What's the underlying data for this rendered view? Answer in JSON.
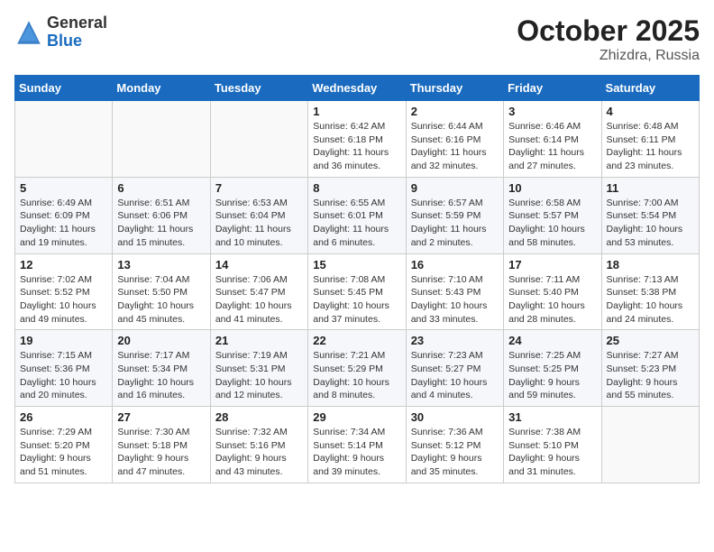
{
  "header": {
    "logo_general": "General",
    "logo_blue": "Blue",
    "month_year": "October 2025",
    "location": "Zhizdra, Russia"
  },
  "calendar": {
    "weekdays": [
      "Sunday",
      "Monday",
      "Tuesday",
      "Wednesday",
      "Thursday",
      "Friday",
      "Saturday"
    ],
    "weeks": [
      [
        {
          "day": "",
          "info": ""
        },
        {
          "day": "",
          "info": ""
        },
        {
          "day": "",
          "info": ""
        },
        {
          "day": "1",
          "info": "Sunrise: 6:42 AM\nSunset: 6:18 PM\nDaylight: 11 hours\nand 36 minutes."
        },
        {
          "day": "2",
          "info": "Sunrise: 6:44 AM\nSunset: 6:16 PM\nDaylight: 11 hours\nand 32 minutes."
        },
        {
          "day": "3",
          "info": "Sunrise: 6:46 AM\nSunset: 6:14 PM\nDaylight: 11 hours\nand 27 minutes."
        },
        {
          "day": "4",
          "info": "Sunrise: 6:48 AM\nSunset: 6:11 PM\nDaylight: 11 hours\nand 23 minutes."
        }
      ],
      [
        {
          "day": "5",
          "info": "Sunrise: 6:49 AM\nSunset: 6:09 PM\nDaylight: 11 hours\nand 19 minutes."
        },
        {
          "day": "6",
          "info": "Sunrise: 6:51 AM\nSunset: 6:06 PM\nDaylight: 11 hours\nand 15 minutes."
        },
        {
          "day": "7",
          "info": "Sunrise: 6:53 AM\nSunset: 6:04 PM\nDaylight: 11 hours\nand 10 minutes."
        },
        {
          "day": "8",
          "info": "Sunrise: 6:55 AM\nSunset: 6:01 PM\nDaylight: 11 hours\nand 6 minutes."
        },
        {
          "day": "9",
          "info": "Sunrise: 6:57 AM\nSunset: 5:59 PM\nDaylight: 11 hours\nand 2 minutes."
        },
        {
          "day": "10",
          "info": "Sunrise: 6:58 AM\nSunset: 5:57 PM\nDaylight: 10 hours\nand 58 minutes."
        },
        {
          "day": "11",
          "info": "Sunrise: 7:00 AM\nSunset: 5:54 PM\nDaylight: 10 hours\nand 53 minutes."
        }
      ],
      [
        {
          "day": "12",
          "info": "Sunrise: 7:02 AM\nSunset: 5:52 PM\nDaylight: 10 hours\nand 49 minutes."
        },
        {
          "day": "13",
          "info": "Sunrise: 7:04 AM\nSunset: 5:50 PM\nDaylight: 10 hours\nand 45 minutes."
        },
        {
          "day": "14",
          "info": "Sunrise: 7:06 AM\nSunset: 5:47 PM\nDaylight: 10 hours\nand 41 minutes."
        },
        {
          "day": "15",
          "info": "Sunrise: 7:08 AM\nSunset: 5:45 PM\nDaylight: 10 hours\nand 37 minutes."
        },
        {
          "day": "16",
          "info": "Sunrise: 7:10 AM\nSunset: 5:43 PM\nDaylight: 10 hours\nand 33 minutes."
        },
        {
          "day": "17",
          "info": "Sunrise: 7:11 AM\nSunset: 5:40 PM\nDaylight: 10 hours\nand 28 minutes."
        },
        {
          "day": "18",
          "info": "Sunrise: 7:13 AM\nSunset: 5:38 PM\nDaylight: 10 hours\nand 24 minutes."
        }
      ],
      [
        {
          "day": "19",
          "info": "Sunrise: 7:15 AM\nSunset: 5:36 PM\nDaylight: 10 hours\nand 20 minutes."
        },
        {
          "day": "20",
          "info": "Sunrise: 7:17 AM\nSunset: 5:34 PM\nDaylight: 10 hours\nand 16 minutes."
        },
        {
          "day": "21",
          "info": "Sunrise: 7:19 AM\nSunset: 5:31 PM\nDaylight: 10 hours\nand 12 minutes."
        },
        {
          "day": "22",
          "info": "Sunrise: 7:21 AM\nSunset: 5:29 PM\nDaylight: 10 hours\nand 8 minutes."
        },
        {
          "day": "23",
          "info": "Sunrise: 7:23 AM\nSunset: 5:27 PM\nDaylight: 10 hours\nand 4 minutes."
        },
        {
          "day": "24",
          "info": "Sunrise: 7:25 AM\nSunset: 5:25 PM\nDaylight: 9 hours\nand 59 minutes."
        },
        {
          "day": "25",
          "info": "Sunrise: 7:27 AM\nSunset: 5:23 PM\nDaylight: 9 hours\nand 55 minutes."
        }
      ],
      [
        {
          "day": "26",
          "info": "Sunrise: 7:29 AM\nSunset: 5:20 PM\nDaylight: 9 hours\nand 51 minutes."
        },
        {
          "day": "27",
          "info": "Sunrise: 7:30 AM\nSunset: 5:18 PM\nDaylight: 9 hours\nand 47 minutes."
        },
        {
          "day": "28",
          "info": "Sunrise: 7:32 AM\nSunset: 5:16 PM\nDaylight: 9 hours\nand 43 minutes."
        },
        {
          "day": "29",
          "info": "Sunrise: 7:34 AM\nSunset: 5:14 PM\nDaylight: 9 hours\nand 39 minutes."
        },
        {
          "day": "30",
          "info": "Sunrise: 7:36 AM\nSunset: 5:12 PM\nDaylight: 9 hours\nand 35 minutes."
        },
        {
          "day": "31",
          "info": "Sunrise: 7:38 AM\nSunset: 5:10 PM\nDaylight: 9 hours\nand 31 minutes."
        },
        {
          "day": "",
          "info": ""
        }
      ]
    ]
  }
}
